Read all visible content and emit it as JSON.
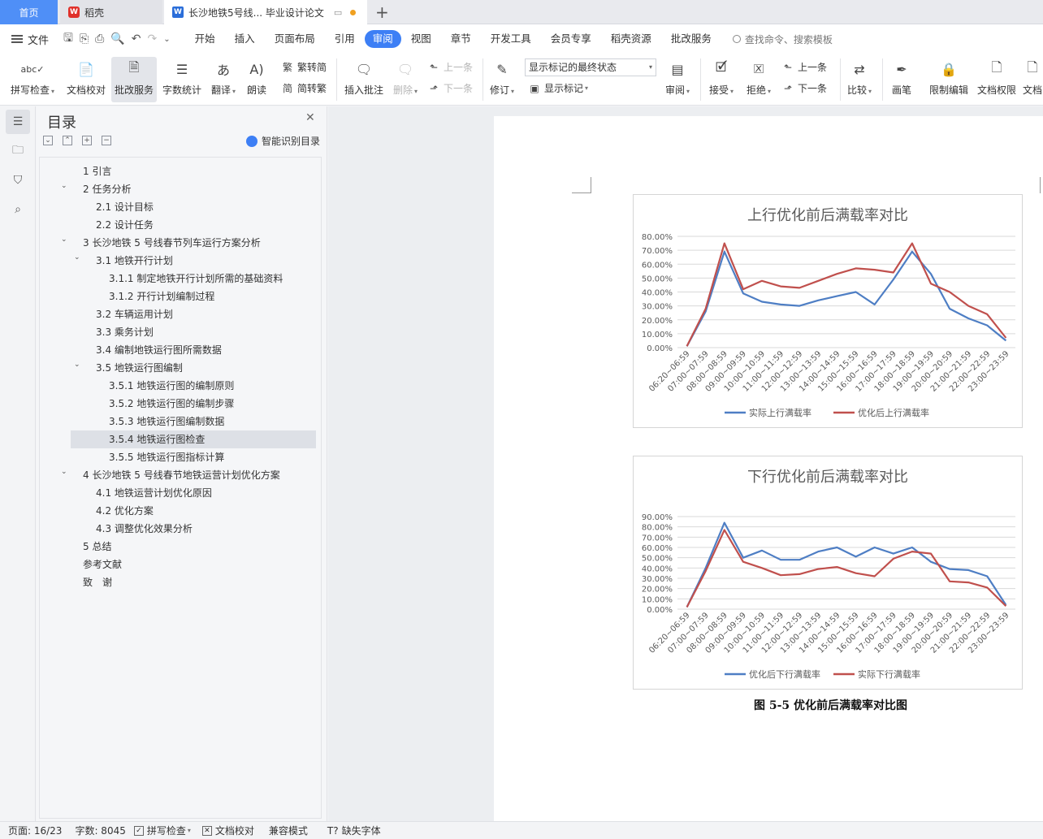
{
  "tabs": {
    "home": "首页",
    "wps": "稻壳",
    "doc": "长沙地铁5号线... 毕业设计论文"
  },
  "menu": {
    "file": "文件",
    "items": [
      "开始",
      "插入",
      "页面布局",
      "引用",
      "审阅",
      "视图",
      "章节",
      "开发工具",
      "会员专享",
      "稻壳资源",
      "批改服务"
    ],
    "active": "审阅",
    "search": "查找命令、搜索模板"
  },
  "ribbon": {
    "spell": "拼写检查",
    "proof": "文档校对",
    "review_service": "批改服务",
    "word_count": "字数统计",
    "translate": "翻译",
    "read": "朗读",
    "trad_to_simp": "繁转简",
    "simp_to_trad": "简转繁",
    "insert_comment": "插入批注",
    "delete": "删除",
    "prev": "上一条",
    "next": "下一条",
    "revise": "修订",
    "show_state": "显示标记的最终状态",
    "show_marks": "显示标记",
    "review": "审阅",
    "accept": "接受",
    "reject": "拒绝",
    "prev2": "上一条",
    "next2": "下一条",
    "compare": "比较",
    "pen": "画笔",
    "restrict": "限制编辑",
    "doc_perm": "文档权限",
    "doc_more": "文档"
  },
  "toc": {
    "title": "目录",
    "ai": "智能识别目录",
    "items": [
      "1 引言",
      "2 任务分析",
      "2.1 设计目标",
      "2.2 设计任务",
      "3 长沙地铁 5 号线春节列车运行方案分析",
      "3.1 地铁开行计划",
      "3.1.1 制定地铁开行计划所需的基础资料",
      "3.1.2 开行计划编制过程",
      "3.2 车辆运用计划",
      "3.3 乘务计划",
      "3.4 编制地铁运行图所需数据",
      "3.5 地铁运行图编制",
      "3.5.1 地铁运行图的编制原则",
      "3.5.2 地铁运行图的编制步骤",
      "3.5.3 地铁运行图编制数据",
      "3.5.4 地铁运行图检查",
      "3.5.5 地铁运行图指标计算",
      "4 长沙地铁 5 号线春节地铁运营计划优化方案",
      "4.1 地铁运营计划优化原因",
      "4.2 优化方案",
      "4.3 调整优化效果分析",
      "5 总结",
      "参考文献",
      "致　谢"
    ]
  },
  "caption": "图 5-5  优化前后满载率对比图",
  "status": {
    "page": "页面: 16/23",
    "words": "字数: 8045",
    "spell": "拼写检查",
    "proof": "文档校对",
    "compat": "兼容模式",
    "missing_font": "缺失字体"
  },
  "colors": {
    "blue": "#4e7ec4",
    "red": "#c0504d",
    "accent": "#3d7ff5"
  },
  "chart_data": [
    {
      "type": "line",
      "title": "上行优化前后满载率对比",
      "categories": [
        "06:20~06:59",
        "07:00~07:59",
        "08:00~08:59",
        "09:00~09:59",
        "10:00~10:59",
        "11:00~11:59",
        "12:00~12:59",
        "13:00~13:59",
        "14:00~14:59",
        "15:00~15:59",
        "16:00~16:59",
        "17:00~17:59",
        "18:00~18:59",
        "19:00~19:59",
        "20:00~20:59",
        "21:00~21:59",
        "22:00~22:59",
        "23:00~23:59"
      ],
      "yticks": [
        "0.00%",
        "10.00%",
        "20.00%",
        "30.00%",
        "40.00%",
        "50.00%",
        "60.00%",
        "70.00%",
        "80.00%"
      ],
      "ylim": [
        0,
        80
      ],
      "series": [
        {
          "name": "实际上行满载率",
          "color": "#4e7ec4",
          "values": [
            1,
            26,
            69,
            39,
            33,
            31,
            30,
            34,
            37,
            40,
            31,
            49,
            69,
            53,
            28,
            21,
            16,
            5
          ]
        },
        {
          "name": "优化后上行满载率",
          "color": "#c0504d",
          "values": [
            1,
            28,
            75,
            42,
            48,
            44,
            43,
            48,
            53,
            57,
            56,
            54,
            75,
            46,
            40,
            30,
            24,
            7
          ]
        }
      ]
    },
    {
      "type": "line",
      "title": "下行优化前后满载率对比",
      "categories": [
        "06:20~06:59",
        "07:00~07:59",
        "08:00~08:59",
        "09:00~09:59",
        "10:00~10:59",
        "11:00~11:59",
        "12:00~12:59",
        "13:00~13:59",
        "14:00~14:59",
        "15:00~15:59",
        "16:00~16:59",
        "17:00~17:59",
        "18:00~18:59",
        "19:00~19:59",
        "20:00~20:59",
        "21:00~21:59",
        "22:00~22:59",
        "23:00~23:59"
      ],
      "yticks": [
        "0.00%",
        "10.00%",
        "20.00%",
        "30.00%",
        "40.00%",
        "50.00%",
        "60.00%",
        "70.00%",
        "80.00%",
        "90.00%"
      ],
      "ylim": [
        0,
        90
      ],
      "series": [
        {
          "name": "优化后下行满载率",
          "color": "#4e7ec4",
          "values": [
            2,
            40,
            84,
            50,
            57,
            48,
            48,
            56,
            60,
            51,
            60,
            54,
            60,
            46,
            39,
            38,
            32,
            4
          ]
        },
        {
          "name": "实际下行满载率",
          "color": "#c0504d",
          "values": [
            2,
            37,
            77,
            46,
            40,
            33,
            34,
            39,
            41,
            35,
            32,
            49,
            56,
            54,
            27,
            26,
            21,
            3
          ]
        }
      ]
    }
  ]
}
